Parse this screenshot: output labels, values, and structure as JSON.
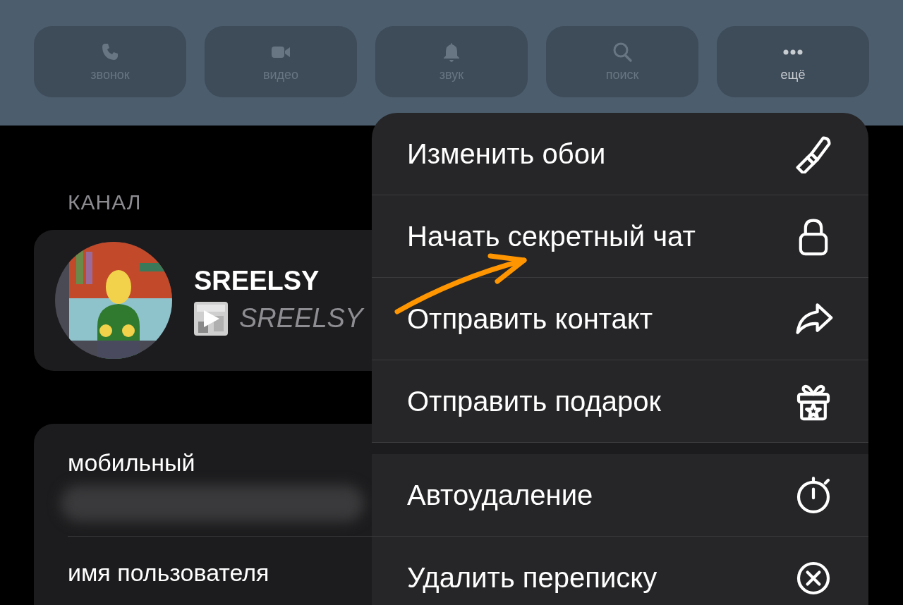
{
  "action_buttons": [
    {
      "label": "звонок",
      "kind": "call",
      "disabled": true
    },
    {
      "label": "видео",
      "kind": "video",
      "disabled": true
    },
    {
      "label": "звук",
      "kind": "sound",
      "disabled": true
    },
    {
      "label": "поиск",
      "kind": "search",
      "disabled": true
    },
    {
      "label": "ещё",
      "kind": "more",
      "disabled": false
    }
  ],
  "section_title": "КАНАЛ",
  "channel": {
    "name": "SREELSY",
    "subtitle": "SREELSY"
  },
  "contact_fields": [
    {
      "label": "мобильный",
      "kind": "redacted"
    },
    {
      "label": "имя пользователя",
      "kind": "plain"
    }
  ],
  "menu": {
    "groups": [
      [
        {
          "label": "Изменить обои",
          "kind": "brush"
        },
        {
          "label": "Начать секретный чат",
          "kind": "lock"
        },
        {
          "label": "Отправить контакт",
          "kind": "share"
        },
        {
          "label": "Отправить подарок",
          "kind": "gift"
        }
      ],
      [
        {
          "label": "Автоудаление",
          "kind": "timer"
        },
        {
          "label": "Удалить переписку",
          "kind": "delete"
        }
      ]
    ]
  }
}
